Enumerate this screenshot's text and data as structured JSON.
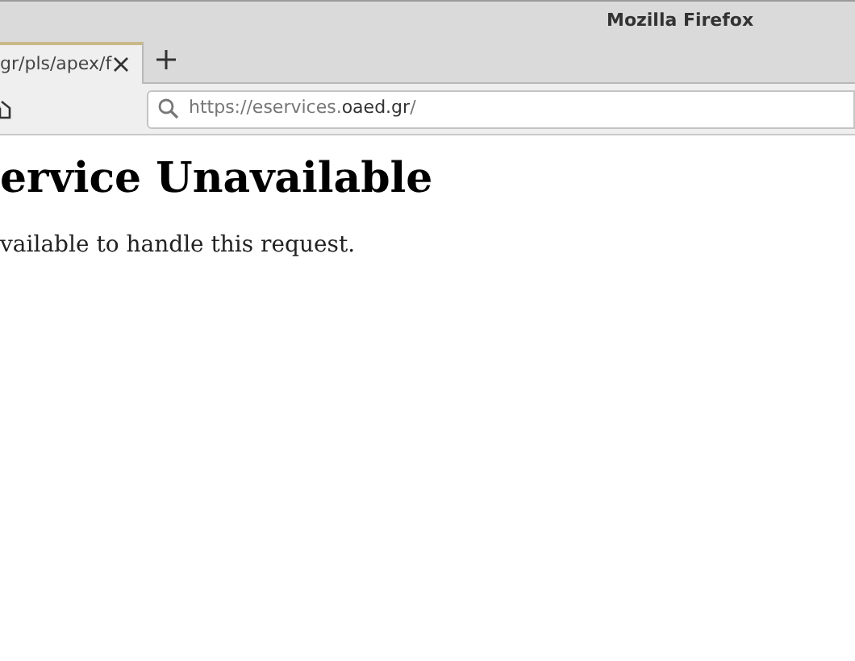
{
  "window": {
    "title": "Mozilla Firefox"
  },
  "tabs": [
    {
      "label": "gr/pls/apex/f",
      "selected": true
    }
  ],
  "address_bar": {
    "url": "https://eservices.**oaed.gr**/"
  },
  "page": {
    "heading": "ervice Unavailable",
    "message": "vailable to handle this request."
  }
}
